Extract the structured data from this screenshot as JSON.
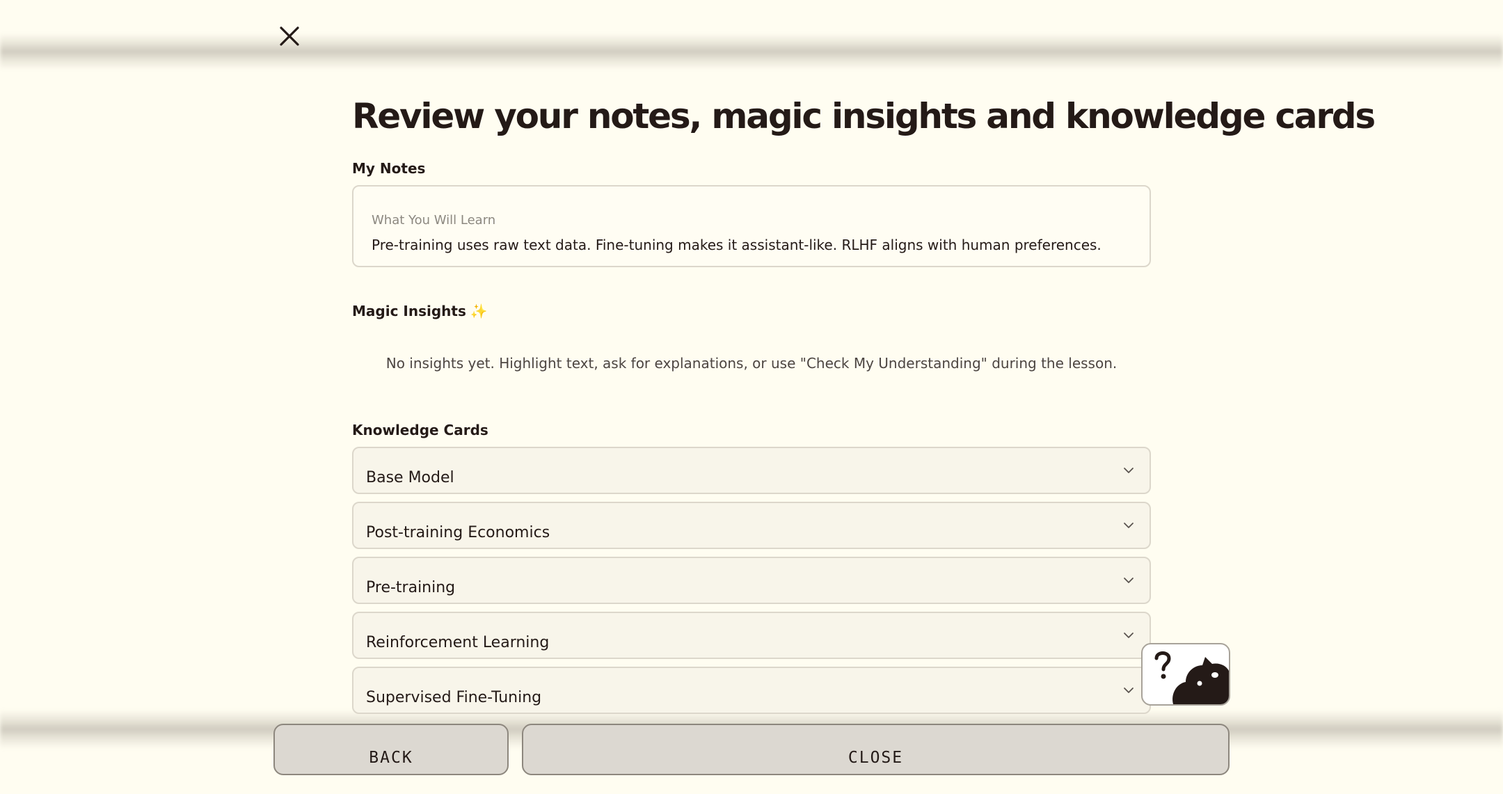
{
  "page": {
    "title": "Review your notes, magic insights and knowledge cards"
  },
  "notes": {
    "label": "My Notes",
    "heading": "What You Will Learn",
    "text": "Pre-training uses raw text data. Fine-tuning makes it assistant-like. RLHF aligns with human preferences."
  },
  "insights": {
    "label": "Magic Insights",
    "sparkle": "✨",
    "empty_text": "No insights yet. Highlight text, ask for explanations, or use \"Check My Understanding\" during the lesson."
  },
  "knowledge_cards": {
    "label": "Knowledge Cards",
    "items": [
      {
        "title": "Base Model"
      },
      {
        "title": "Post-training Economics"
      },
      {
        "title": "Pre-training"
      },
      {
        "title": "Reinforcement Learning"
      },
      {
        "title": "Supervised Fine-Tuning"
      }
    ]
  },
  "footer": {
    "back_label": "BACK",
    "close_label": "CLOSE"
  },
  "icons": {
    "close": "close-icon",
    "chevron": "chevron-down-icon",
    "mascot": "mascot-question-icon",
    "sparkle": "sparkles-icon"
  },
  "colors": {
    "background": "#fffdf1",
    "text": "#241a17",
    "card_bg": "#f8f5ea",
    "border": "#dcd7cb",
    "button_bg": "#dcd8d1",
    "sparkle": "#e8c84a"
  }
}
